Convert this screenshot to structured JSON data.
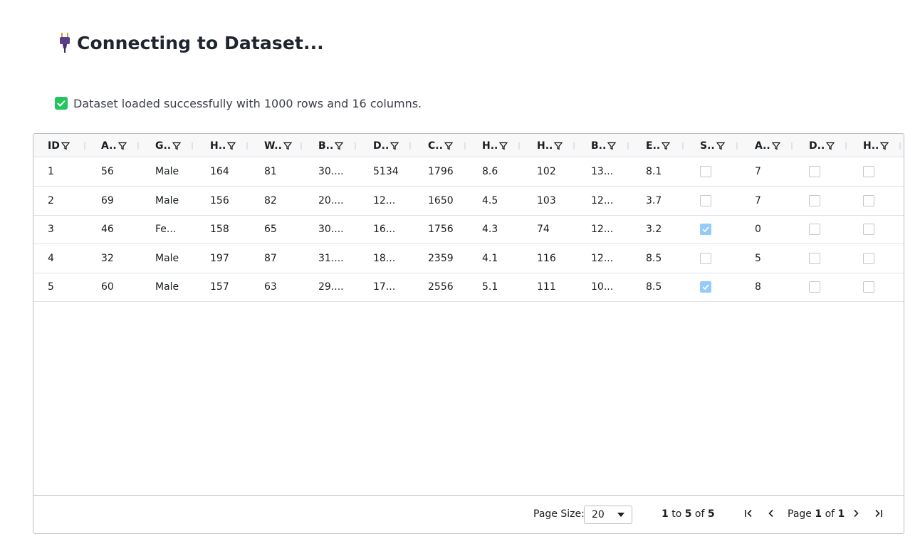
{
  "page": {
    "title": "Connecting to Dataset...",
    "title_icon": "electric-plug-icon"
  },
  "status": {
    "icon": "green-check-icon",
    "message": "Dataset loaded successfully with 1000 rows and 16 columns."
  },
  "colors": {
    "success_green": "#22c55e",
    "checkbox_checked": "#93cbf9",
    "grid_border": "#babfc7",
    "header_bg": "#f8f8f8"
  },
  "grid": {
    "columns": [
      "ID",
      "A..",
      "G..",
      "H..",
      "W..",
      "B..",
      "D..",
      "C..",
      "H..",
      "H..",
      "B..",
      "E..",
      "S..",
      "A..",
      "D..",
      "H.."
    ],
    "column_icon": "filter-icon",
    "rows": [
      [
        "1",
        "56",
        "Male",
        "164",
        "81",
        "30....",
        "5134",
        "1796",
        "8.6",
        "102",
        "13...",
        "8.1",
        false,
        "7",
        false,
        false
      ],
      [
        "2",
        "69",
        "Male",
        "156",
        "82",
        "20....",
        "12...",
        "1650",
        "4.5",
        "103",
        "12...",
        "3.7",
        false,
        "7",
        false,
        false
      ],
      [
        "3",
        "46",
        "Fe...",
        "158",
        "65",
        "30....",
        "16...",
        "1756",
        "4.3",
        "74",
        "12...",
        "3.2",
        true,
        "0",
        false,
        false
      ],
      [
        "4",
        "32",
        "Male",
        "197",
        "87",
        "31....",
        "18...",
        "2359",
        "4.1",
        "116",
        "12...",
        "8.5",
        false,
        "5",
        false,
        false
      ],
      [
        "5",
        "60",
        "Male",
        "157",
        "63",
        "29....",
        "17...",
        "2556",
        "5.1",
        "111",
        "10...",
        "8.5",
        true,
        "8",
        false,
        false
      ]
    ]
  },
  "pagination": {
    "page_size_label": "Page Size:",
    "page_size_value": "20",
    "row_from": "1",
    "row_to_word": "to",
    "row_to": "5",
    "of_word": "of",
    "row_total": "5",
    "page_word": "Page",
    "page_current": "1",
    "page_total": "1",
    "first_icon": "first-page-icon",
    "prev_icon": "previous-page-icon",
    "next_icon": "next-page-icon",
    "last_icon": "last-page-icon"
  }
}
